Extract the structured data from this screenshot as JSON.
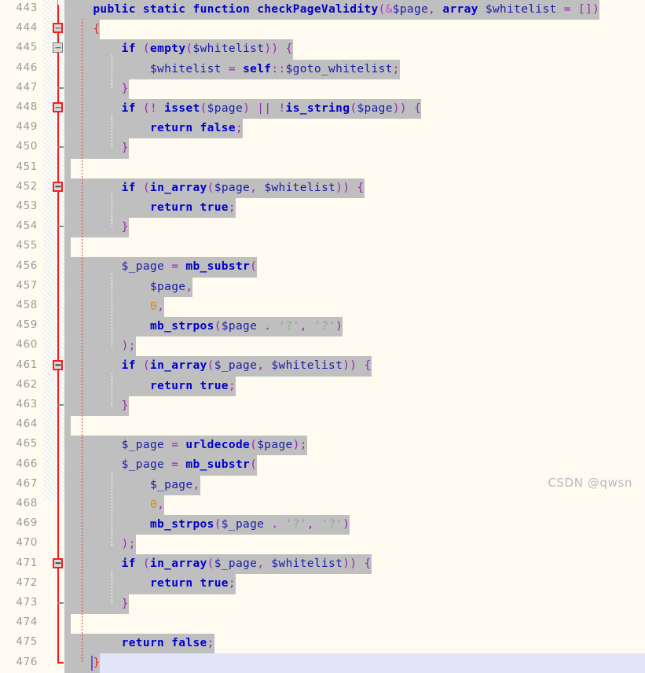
{
  "editor": {
    "language": "php",
    "first_line": 443,
    "last_line": 476,
    "current_line": 476,
    "colors": {
      "background": "#fffbf0",
      "selection": "#bfbfbf",
      "current_line": "#e4e4f8",
      "line_number": "#9a9a9a",
      "fold_marker": "#ff1a1a",
      "keyword": "#0000d0",
      "function": "#0000c8",
      "variable": "#1a1aaa",
      "punctuation": "#9c27b0",
      "number": "#e8860b",
      "string": "#9f9f9f",
      "caret": "#7b4ad1"
    }
  },
  "watermark": {
    "text": "CSDN @qwsn"
  },
  "lines": [
    {
      "n": 443,
      "fold": "none",
      "indent": 0,
      "text": "    public static function checkPageValidity(&$page, array $whitelist = [])"
    },
    {
      "n": 444,
      "fold": "red-box",
      "indent": 0,
      "text": "    {"
    },
    {
      "n": 445,
      "fold": "gray-box",
      "indent": 1,
      "text": "        if (empty($whitelist)) {"
    },
    {
      "n": 446,
      "fold": "none",
      "indent": 2,
      "text": "            $whitelist = self::$goto_whitelist;"
    },
    {
      "n": 447,
      "fold": "tick",
      "indent": 1,
      "text": "        }"
    },
    {
      "n": 448,
      "fold": "red-box",
      "indent": 1,
      "text": "        if (! isset($page) || !is_string($page)) {"
    },
    {
      "n": 449,
      "fold": "none",
      "indent": 2,
      "text": "            return false;"
    },
    {
      "n": 450,
      "fold": "tick",
      "indent": 1,
      "text": "        }"
    },
    {
      "n": 451,
      "fold": "none",
      "indent": 0,
      "text": ""
    },
    {
      "n": 452,
      "fold": "red-box",
      "indent": 1,
      "text": "        if (in_array($page, $whitelist)) {"
    },
    {
      "n": 453,
      "fold": "none",
      "indent": 2,
      "text": "            return true;"
    },
    {
      "n": 454,
      "fold": "tick",
      "indent": 1,
      "text": "        }"
    },
    {
      "n": 455,
      "fold": "none",
      "indent": 0,
      "text": ""
    },
    {
      "n": 456,
      "fold": "none",
      "indent": 1,
      "text": "        $_page = mb_substr("
    },
    {
      "n": 457,
      "fold": "none",
      "indent": 2,
      "text": "            $page,"
    },
    {
      "n": 458,
      "fold": "none",
      "indent": 2,
      "text": "            0,"
    },
    {
      "n": 459,
      "fold": "none",
      "indent": 2,
      "text": "            mb_strpos($page . '?', '?')"
    },
    {
      "n": 460,
      "fold": "none",
      "indent": 1,
      "text": "        );"
    },
    {
      "n": 461,
      "fold": "red-box",
      "indent": 1,
      "text": "        if (in_array($_page, $whitelist)) {"
    },
    {
      "n": 462,
      "fold": "none",
      "indent": 2,
      "text": "            return true;"
    },
    {
      "n": 463,
      "fold": "tick",
      "indent": 1,
      "text": "        }"
    },
    {
      "n": 464,
      "fold": "none",
      "indent": 0,
      "text": ""
    },
    {
      "n": 465,
      "fold": "none",
      "indent": 1,
      "text": "        $_page = urldecode($page);"
    },
    {
      "n": 466,
      "fold": "none",
      "indent": 1,
      "text": "        $_page = mb_substr("
    },
    {
      "n": 467,
      "fold": "none",
      "indent": 2,
      "text": "            $_page,"
    },
    {
      "n": 468,
      "fold": "none",
      "indent": 2,
      "text": "            0,"
    },
    {
      "n": 469,
      "fold": "none",
      "indent": 2,
      "text": "            mb_strpos($_page . '?', '?')"
    },
    {
      "n": 470,
      "fold": "none",
      "indent": 1,
      "text": "        );"
    },
    {
      "n": 471,
      "fold": "red-box",
      "indent": 1,
      "text": "        if (in_array($_page, $whitelist)) {"
    },
    {
      "n": 472,
      "fold": "none",
      "indent": 2,
      "text": "            return true;"
    },
    {
      "n": 473,
      "fold": "tick",
      "indent": 1,
      "text": "        }"
    },
    {
      "n": 474,
      "fold": "none",
      "indent": 0,
      "text": ""
    },
    {
      "n": 475,
      "fold": "none",
      "indent": 1,
      "text": "        return false;"
    },
    {
      "n": 476,
      "fold": "tick",
      "indent": 0,
      "text": "    }"
    }
  ],
  "tokens": {
    "443": [
      [
        "ws",
        "    "
      ],
      [
        "kw",
        "public"
      ],
      [
        "ws",
        " "
      ],
      [
        "kw",
        "static"
      ],
      [
        "ws",
        " "
      ],
      [
        "kw",
        "function"
      ],
      [
        "ws",
        " "
      ],
      [
        "fn",
        "checkPageValidity"
      ],
      [
        "punc",
        "("
      ],
      [
        "amp",
        "&"
      ],
      [
        "var",
        "$page"
      ],
      [
        "punc",
        ","
      ],
      [
        "ws",
        " "
      ],
      [
        "kw",
        "array"
      ],
      [
        "ws",
        " "
      ],
      [
        "var",
        "$whitelist"
      ],
      [
        "ws",
        " "
      ],
      [
        "op",
        "="
      ],
      [
        "ws",
        " "
      ],
      [
        "punc",
        "[])"
      ]
    ],
    "444": [
      [
        "ws",
        "    "
      ],
      [
        "red",
        "{"
      ]
    ],
    "445": [
      [
        "ws",
        "        "
      ],
      [
        "kw",
        "if"
      ],
      [
        "ws",
        " "
      ],
      [
        "punc",
        "("
      ],
      [
        "fn",
        "empty"
      ],
      [
        "punc",
        "("
      ],
      [
        "var",
        "$whitelist"
      ],
      [
        "punc",
        "))"
      ],
      [
        "ws",
        " "
      ],
      [
        "punc",
        "{"
      ]
    ],
    "446": [
      [
        "ws",
        "            "
      ],
      [
        "var",
        "$whitelist"
      ],
      [
        "ws",
        " "
      ],
      [
        "op",
        "="
      ],
      [
        "ws",
        " "
      ],
      [
        "kw",
        "self"
      ],
      [
        "punc",
        "::"
      ],
      [
        "var",
        "$goto_whitelist"
      ],
      [
        "punc",
        ";"
      ]
    ],
    "447": [
      [
        "ws",
        "        "
      ],
      [
        "punc",
        "}"
      ]
    ],
    "448": [
      [
        "ws",
        "        "
      ],
      [
        "kw",
        "if"
      ],
      [
        "ws",
        " "
      ],
      [
        "punc",
        "(!"
      ],
      [
        "ws",
        " "
      ],
      [
        "fn",
        "isset"
      ],
      [
        "punc",
        "("
      ],
      [
        "var",
        "$page"
      ],
      [
        "punc",
        ")"
      ],
      [
        "ws",
        " "
      ],
      [
        "op",
        "||"
      ],
      [
        "ws",
        " "
      ],
      [
        "op",
        "!"
      ],
      [
        "fn",
        "is_string"
      ],
      [
        "punc",
        "("
      ],
      [
        "var",
        "$page"
      ],
      [
        "punc",
        "))"
      ],
      [
        "ws",
        " "
      ],
      [
        "punc",
        "{"
      ]
    ],
    "449": [
      [
        "ws",
        "            "
      ],
      [
        "kw",
        "return"
      ],
      [
        "ws",
        " "
      ],
      [
        "kw",
        "false"
      ],
      [
        "punc",
        ";"
      ]
    ],
    "450": [
      [
        "ws",
        "        "
      ],
      [
        "punc",
        "}"
      ]
    ],
    "452": [
      [
        "ws",
        "        "
      ],
      [
        "kw",
        "if"
      ],
      [
        "ws",
        " "
      ],
      [
        "punc",
        "("
      ],
      [
        "fn",
        "in_array"
      ],
      [
        "punc",
        "("
      ],
      [
        "var",
        "$page"
      ],
      [
        "punc",
        ","
      ],
      [
        "ws",
        " "
      ],
      [
        "var",
        "$whitelist"
      ],
      [
        "punc",
        "))"
      ],
      [
        "ws",
        " "
      ],
      [
        "punc",
        "{"
      ]
    ],
    "453": [
      [
        "ws",
        "            "
      ],
      [
        "kw",
        "return"
      ],
      [
        "ws",
        " "
      ],
      [
        "kw",
        "true"
      ],
      [
        "punc",
        ";"
      ]
    ],
    "454": [
      [
        "ws",
        "        "
      ],
      [
        "punc",
        "}"
      ]
    ],
    "456": [
      [
        "ws",
        "        "
      ],
      [
        "var",
        "$_page"
      ],
      [
        "ws",
        " "
      ],
      [
        "op",
        "="
      ],
      [
        "ws",
        " "
      ],
      [
        "fn",
        "mb_substr"
      ],
      [
        "punc",
        "("
      ]
    ],
    "457": [
      [
        "ws",
        "            "
      ],
      [
        "var",
        "$page"
      ],
      [
        "punc",
        ","
      ]
    ],
    "458": [
      [
        "ws",
        "            "
      ],
      [
        "num",
        "0"
      ],
      [
        "punc",
        ","
      ]
    ],
    "459": [
      [
        "ws",
        "            "
      ],
      [
        "fn",
        "mb_strpos"
      ],
      [
        "punc",
        "("
      ],
      [
        "var",
        "$page"
      ],
      [
        "ws",
        " "
      ],
      [
        "punc",
        "."
      ],
      [
        "ws",
        " "
      ],
      [
        "str",
        "'?'"
      ],
      [
        "punc",
        ","
      ],
      [
        "ws",
        " "
      ],
      [
        "str",
        "'?'"
      ],
      [
        "punc",
        ")"
      ]
    ],
    "460": [
      [
        "ws",
        "        "
      ],
      [
        "punc",
        ");"
      ]
    ],
    "461": [
      [
        "ws",
        "        "
      ],
      [
        "kw",
        "if"
      ],
      [
        "ws",
        " "
      ],
      [
        "punc",
        "("
      ],
      [
        "fn",
        "in_array"
      ],
      [
        "punc",
        "("
      ],
      [
        "var",
        "$_page"
      ],
      [
        "punc",
        ","
      ],
      [
        "ws",
        " "
      ],
      [
        "var",
        "$whitelist"
      ],
      [
        "punc",
        "))"
      ],
      [
        "ws",
        " "
      ],
      [
        "punc",
        "{"
      ]
    ],
    "462": [
      [
        "ws",
        "            "
      ],
      [
        "kw",
        "return"
      ],
      [
        "ws",
        " "
      ],
      [
        "kw",
        "true"
      ],
      [
        "punc",
        ";"
      ]
    ],
    "463": [
      [
        "ws",
        "        "
      ],
      [
        "punc",
        "}"
      ]
    ],
    "465": [
      [
        "ws",
        "        "
      ],
      [
        "var",
        "$_page"
      ],
      [
        "ws",
        " "
      ],
      [
        "op",
        "="
      ],
      [
        "ws",
        " "
      ],
      [
        "fn",
        "urldecode"
      ],
      [
        "punc",
        "("
      ],
      [
        "var",
        "$page"
      ],
      [
        "punc",
        ");"
      ]
    ],
    "466": [
      [
        "ws",
        "        "
      ],
      [
        "var",
        "$_page"
      ],
      [
        "ws",
        " "
      ],
      [
        "op",
        "="
      ],
      [
        "ws",
        " "
      ],
      [
        "fn",
        "mb_substr"
      ],
      [
        "punc",
        "("
      ]
    ],
    "467": [
      [
        "ws",
        "            "
      ],
      [
        "var",
        "$_page"
      ],
      [
        "punc",
        ","
      ]
    ],
    "468": [
      [
        "ws",
        "            "
      ],
      [
        "num",
        "0"
      ],
      [
        "punc",
        ","
      ]
    ],
    "469": [
      [
        "ws",
        "            "
      ],
      [
        "fn",
        "mb_strpos"
      ],
      [
        "punc",
        "("
      ],
      [
        "var",
        "$_page"
      ],
      [
        "ws",
        " "
      ],
      [
        "punc",
        "."
      ],
      [
        "ws",
        " "
      ],
      [
        "str",
        "'?'"
      ],
      [
        "punc",
        ","
      ],
      [
        "ws",
        " "
      ],
      [
        "str",
        "'?'"
      ],
      [
        "punc",
        ")"
      ]
    ],
    "470": [
      [
        "ws",
        "        "
      ],
      [
        "punc",
        ");"
      ]
    ],
    "471": [
      [
        "ws",
        "        "
      ],
      [
        "kw",
        "if"
      ],
      [
        "ws",
        " "
      ],
      [
        "punc",
        "("
      ],
      [
        "fn",
        "in_array"
      ],
      [
        "punc",
        "("
      ],
      [
        "var",
        "$_page"
      ],
      [
        "punc",
        ","
      ],
      [
        "ws",
        " "
      ],
      [
        "var",
        "$whitelist"
      ],
      [
        "punc",
        "))"
      ],
      [
        "ws",
        " "
      ],
      [
        "punc",
        "{"
      ]
    ],
    "472": [
      [
        "ws",
        "            "
      ],
      [
        "kw",
        "return"
      ],
      [
        "ws",
        " "
      ],
      [
        "kw",
        "true"
      ],
      [
        "punc",
        ";"
      ]
    ],
    "473": [
      [
        "ws",
        "        "
      ],
      [
        "punc",
        "}"
      ]
    ],
    "475": [
      [
        "ws",
        "        "
      ],
      [
        "kw",
        "return"
      ],
      [
        "ws",
        " "
      ],
      [
        "kw",
        "false"
      ],
      [
        "punc",
        ";"
      ]
    ],
    "476": [
      [
        "ws",
        "    "
      ],
      [
        "red",
        "}"
      ]
    ]
  }
}
